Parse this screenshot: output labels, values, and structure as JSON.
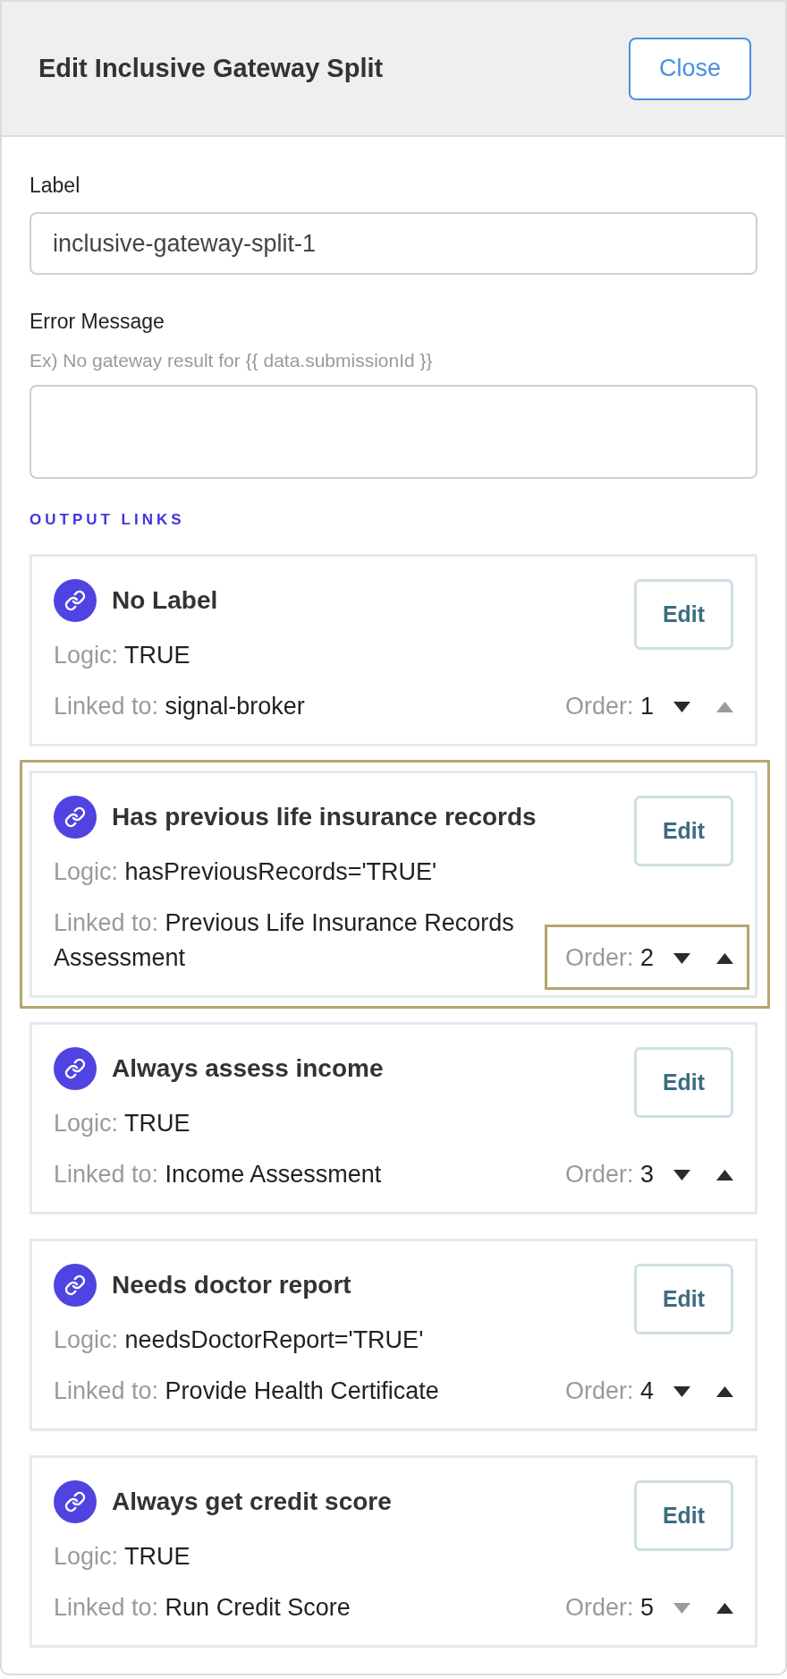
{
  "panel": {
    "title": "Edit Inclusive Gateway Split",
    "close_button": "Close"
  },
  "form": {
    "label_field": {
      "label": "Label",
      "value": "inclusive-gateway-split-1"
    },
    "error_message_field": {
      "label": "Error Message",
      "hint": "Ex) No gateway result for {{ data.submissionId }}"
    }
  },
  "output_links": {
    "heading": "OUTPUT LINKS",
    "links": [
      {
        "title": "No Label",
        "logic_label": "Logic:",
        "logic": "TRUE",
        "linked_label": "Linked to:",
        "linked_to": "signal-broker",
        "order_label": "Order:",
        "order": "1",
        "edit_button": "Edit",
        "down_disabled": false,
        "up_disabled": true,
        "highlighted": false,
        "order_highlighted": false
      },
      {
        "title": "Has previous life insurance records",
        "logic_label": "Logic:",
        "logic": "hasPreviousRecords='TRUE'",
        "linked_label": "Linked to:",
        "linked_to": "Previous Life Insurance Records Assessment",
        "order_label": "Order:",
        "order": "2",
        "edit_button": "Edit",
        "down_disabled": false,
        "up_disabled": false,
        "highlighted": true,
        "order_highlighted": true
      },
      {
        "title": "Always assess income",
        "logic_label": "Logic:",
        "logic": "TRUE",
        "linked_label": "Linked to:",
        "linked_to": "Income Assessment",
        "order_label": "Order:",
        "order": "3",
        "edit_button": "Edit",
        "down_disabled": false,
        "up_disabled": false,
        "highlighted": false,
        "order_highlighted": false
      },
      {
        "title": "Needs doctor report",
        "logic_label": "Logic:",
        "logic": "needsDoctorReport='TRUE'",
        "linked_label": "Linked to:",
        "linked_to": "Provide Health Certificate",
        "order_label": "Order:",
        "order": "4",
        "edit_button": "Edit",
        "down_disabled": false,
        "up_disabled": false,
        "highlighted": false,
        "order_highlighted": false
      },
      {
        "title": "Always get credit score",
        "logic_label": "Logic:",
        "logic": "TRUE",
        "linked_label": "Linked to:",
        "linked_to": "Run Credit Score",
        "order_label": "Order:",
        "order": "5",
        "edit_button": "Edit",
        "down_disabled": true,
        "up_disabled": false,
        "highlighted": false,
        "order_highlighted": false
      }
    ]
  }
}
